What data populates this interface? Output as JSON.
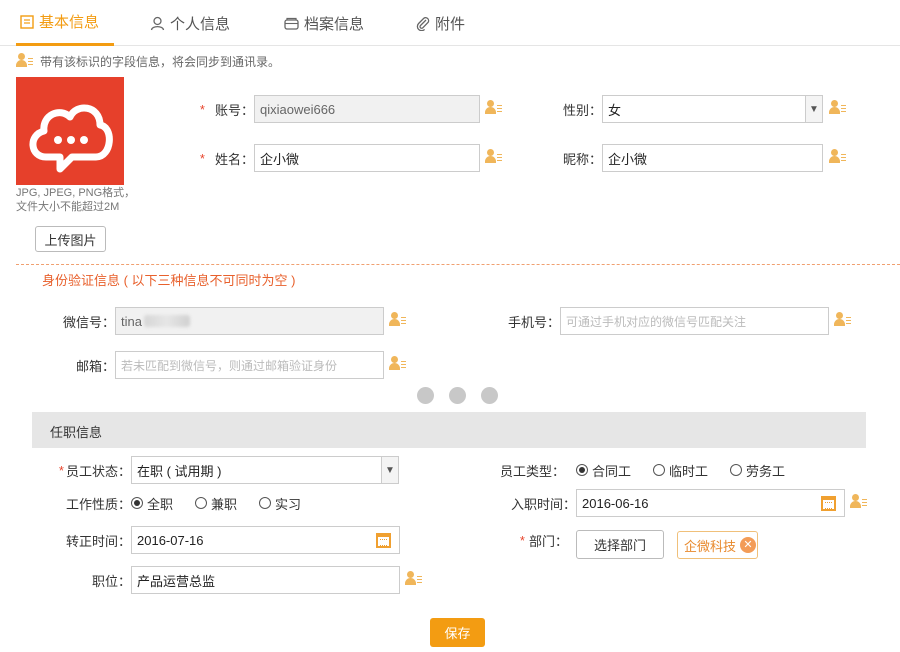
{
  "tabs": [
    {
      "label": "基本信息",
      "icon": "document-icon",
      "active": true
    },
    {
      "label": "个人信息",
      "icon": "user-icon"
    },
    {
      "label": "档案信息",
      "icon": "archive-icon"
    },
    {
      "label": "附件",
      "icon": "paperclip-icon"
    }
  ],
  "sync_note": "带有该标识的字段信息，将会同步到通讯录。",
  "avatar": {
    "hint_line1": "JPG, JPEG, PNG格式，",
    "hint_line2": "文件大小不能超过2M",
    "upload_label": "上传图片"
  },
  "account": {
    "label": "账号：",
    "value": "qixiaowei666",
    "required": "*"
  },
  "gender": {
    "label": "性别：",
    "value": "女"
  },
  "name": {
    "label": "姓名：",
    "value": "企小微",
    "required": "*"
  },
  "nickname": {
    "label": "昵称：",
    "value": "企小微"
  },
  "identity_section_title": "身份验证信息 ( 以下三种信息不可同时为空 )",
  "wechat": {
    "label": "微信号：",
    "value": "tina"
  },
  "mobile": {
    "label": "手机号：",
    "placeholder": "可通过手机对应的微信号匹配关注"
  },
  "email": {
    "label": "邮箱：",
    "placeholder": "若未匹配到微信号，则通过邮箱验证身份"
  },
  "employment_section_title": "任职信息",
  "status": {
    "label": "员工状态：",
    "value": "在职 ( 试用期 )",
    "required": "*"
  },
  "employee_type": {
    "label": "员工类型：",
    "options": [
      "合同工",
      "临时工",
      "劳务工"
    ],
    "selected": "合同工"
  },
  "work_nature": {
    "label": "工作性质：",
    "options": [
      "全职",
      "兼职",
      "实习"
    ],
    "selected": "全职"
  },
  "hire_date": {
    "label": "入职时间：",
    "value": "2016-06-16"
  },
  "regular_date": {
    "label": "转正时间：",
    "value": "2016-07-16"
  },
  "department": {
    "label": "部门：",
    "required": "*",
    "button_label": "选择部门",
    "tag": "企微科技"
  },
  "position": {
    "label": "职位：",
    "value": "产品运营总监"
  },
  "save_label": "保存",
  "colors": {
    "accent": "#f39c12",
    "logo_bg": "#e6402b",
    "required": "#e8452c"
  }
}
